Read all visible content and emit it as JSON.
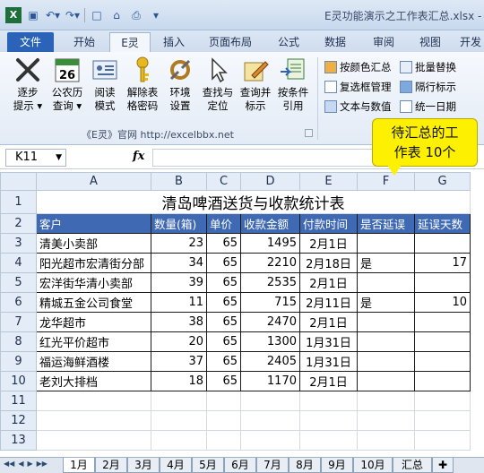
{
  "window": {
    "title": "E灵功能演示之工作表汇总.xlsx -"
  },
  "ribbon_tabs": [
    "文件",
    "开始",
    "E灵",
    "插入",
    "页面布局",
    "公式",
    "数据",
    "审阅",
    "视图",
    "开发"
  ],
  "ribbon_buttons": [
    {
      "label1": "逐步",
      "label2": "提示 ▾"
    },
    {
      "label1": "公农历",
      "label2": "查询 ▾"
    },
    {
      "label1": "阅读",
      "label2": "模式"
    },
    {
      "label1": "解除表",
      "label2": "格密码"
    },
    {
      "label1": "环境",
      "label2": "设置"
    },
    {
      "label1": "查找与",
      "label2": "定位"
    },
    {
      "label1": "查询并",
      "label2": "标示"
    },
    {
      "label1": "按条件",
      "label2": "引用"
    }
  ],
  "calendar_day": "26",
  "small_buttons_col1": [
    "按颜色汇总",
    "复选框管理",
    "文本与数值"
  ],
  "small_buttons_col2": [
    "批量替换",
    "隔行标示",
    "统一日期"
  ],
  "group_label": "《E灵》官网  http://excelbbx.net",
  "formula_bar": {
    "name_box": "K11",
    "fx": "fx"
  },
  "callout": {
    "line1": "待汇总的工",
    "line2": "作表  10个"
  },
  "columns": [
    "A",
    "B",
    "C",
    "D",
    "E",
    "F",
    "G"
  ],
  "sheet_title": "清岛啤酒送货与收款统计表",
  "headers": [
    "客户",
    "数量(箱)",
    "单价",
    "收款金额",
    "付款时间",
    "是否延误",
    "延误天数"
  ],
  "rows": [
    [
      "清美小卖部",
      "23",
      "65",
      "1495",
      "2月1日",
      "",
      ""
    ],
    [
      "阳光超市宏清街分部",
      "34",
      "65",
      "2210",
      "2月18日",
      "是",
      "17"
    ],
    [
      "宏洋街华清小卖部",
      "39",
      "65",
      "2535",
      "2月1日",
      "",
      ""
    ],
    [
      "精城五金公司食堂",
      "11",
      "65",
      "715",
      "2月11日",
      "是",
      "10"
    ],
    [
      "龙华超市",
      "38",
      "65",
      "2470",
      "2月1日",
      "",
      ""
    ],
    [
      "红光平价超市",
      "20",
      "65",
      "1300",
      "1月31日",
      "",
      ""
    ],
    [
      "福运海鲜酒楼",
      "37",
      "65",
      "2405",
      "1月31日",
      "",
      ""
    ],
    [
      "老刘大排档",
      "18",
      "65",
      "1170",
      "2月1日",
      "",
      ""
    ]
  ],
  "row_numbers": [
    "1",
    "2",
    "3",
    "4",
    "5",
    "6",
    "7",
    "8",
    "9",
    "10",
    "11",
    "12",
    "13"
  ],
  "sheet_tabs": [
    "1月",
    "2月",
    "3月",
    "4月",
    "5月",
    "6月",
    "7月",
    "8月",
    "9月",
    "10月",
    "汇总"
  ]
}
